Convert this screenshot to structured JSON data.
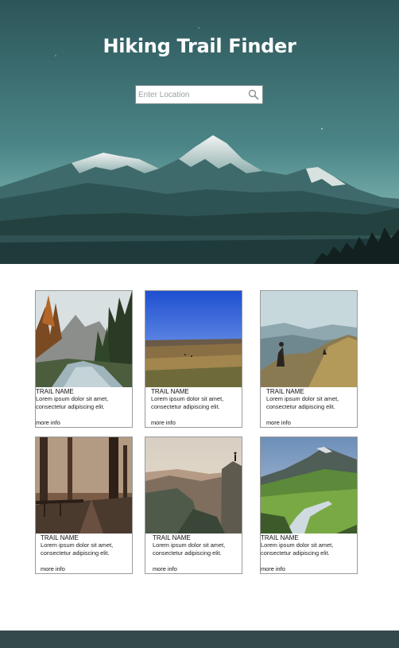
{
  "header": {
    "title": "Hiking Trail Finder",
    "search_placeholder": "Enter Location"
  },
  "cards": [
    {
      "name": "TRAIL NAME",
      "description": "Lorem ipsum dolor sit amet, consectetur adipiscing elit.",
      "link": "more info"
    },
    {
      "name": "TRAIL NAME",
      "description": "Lorem ipsum dolor sit amet, consectetur adipiscing elit.",
      "link": "more info"
    },
    {
      "name": "TRAIL NAME",
      "description": "Lorem ipsum dolor sit amet, consectetur adipiscing elit.",
      "link": "more info"
    },
    {
      "name": "TRAIL NAME",
      "description": "Lorem ipsum dolor sit amet, consectetur adipiscing elit.",
      "link": "more info"
    },
    {
      "name": "TRAIL NAME",
      "description": "Lorem ipsum dolor sit amet, consectetur adipiscing elit.",
      "link": "more info"
    },
    {
      "name": "TRAIL NAME",
      "description": "Lorem ipsum dolor sit amet, consectetur adipiscing elit.",
      "link": "more info"
    }
  ],
  "icons": {
    "search": "search-icon"
  },
  "colors": {
    "hero_teal": "#3c7177",
    "footer": "#34494c",
    "card_border": "#9a9a9a"
  }
}
